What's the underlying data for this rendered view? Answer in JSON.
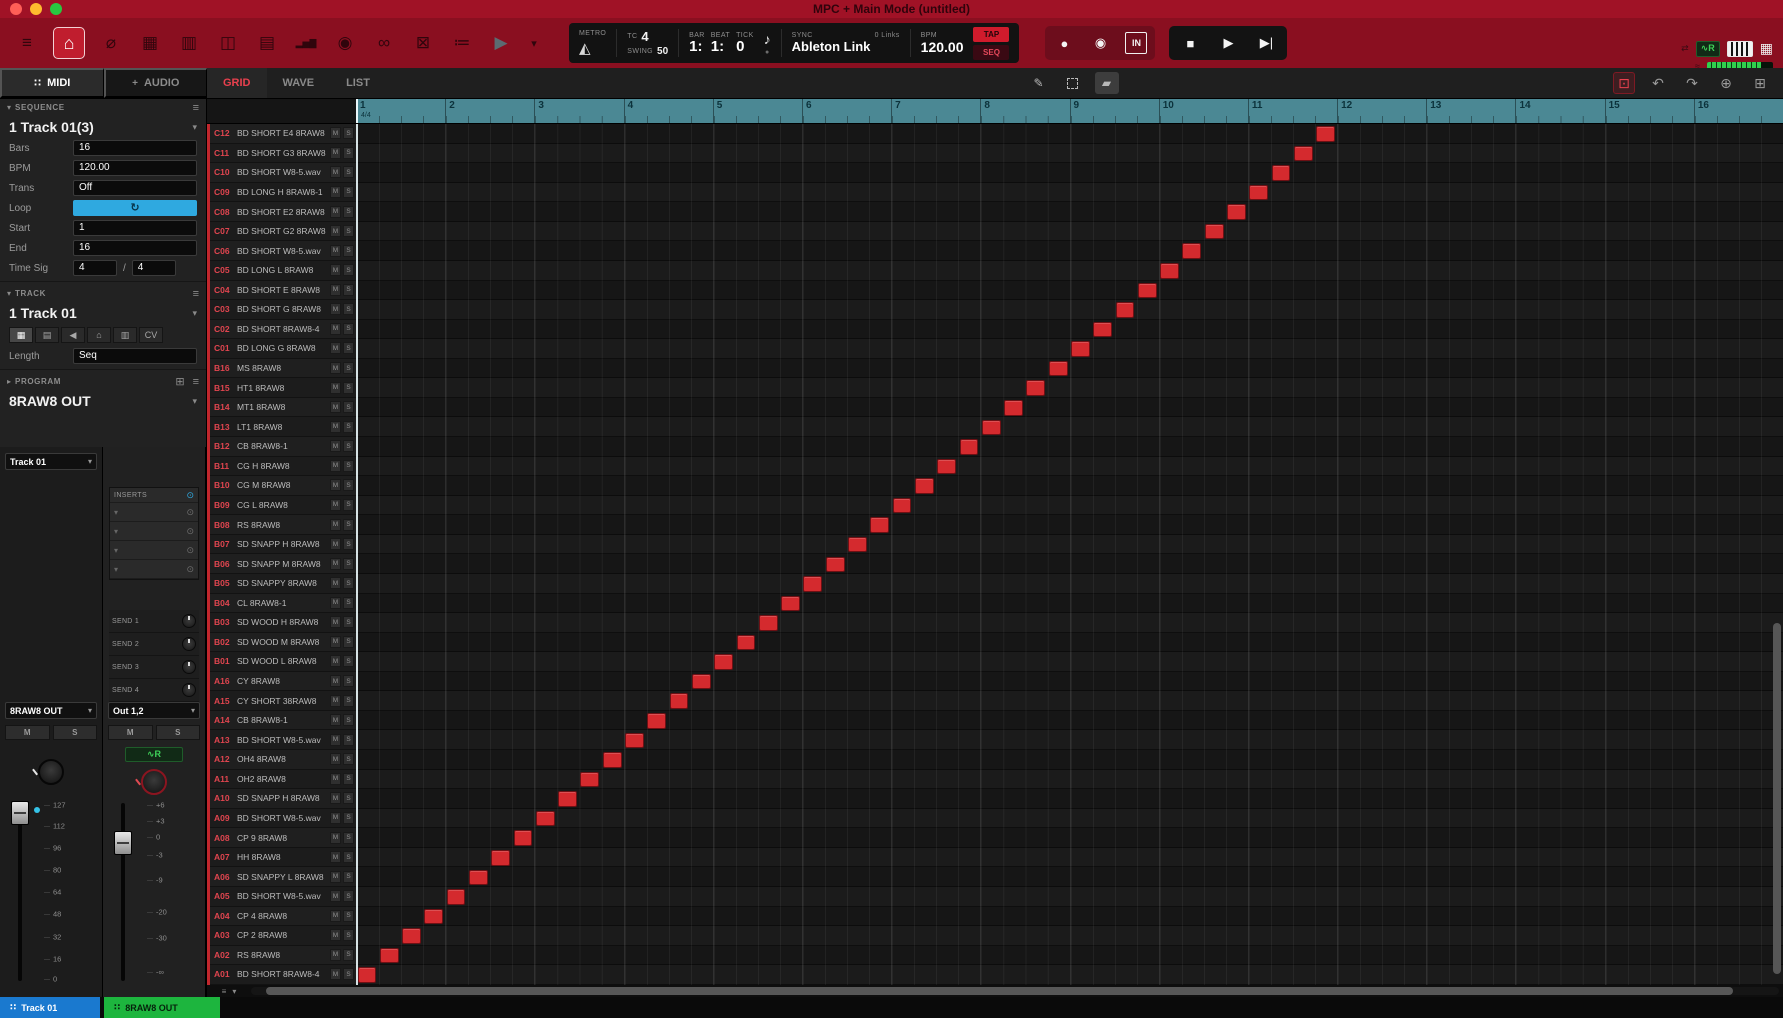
{
  "window": {
    "title": "MPC + Main Mode (untitled)"
  },
  "colors": {
    "accent_red": "#c1272d",
    "note": "#d42a2e",
    "ruler": "#4b8894",
    "loop_toggle": "#2fa9e0",
    "track_tab_blue": "#1a79cf",
    "program_tab_green": "#1db53e",
    "automation_green": "#3ed158"
  },
  "icons": {
    "menu": "≡",
    "main": "⌂",
    "zoom": "⌀",
    "track_view": "▦",
    "list_edit": "▥",
    "step_seq": "◫",
    "mixer": "▤",
    "sampler": "▂▅▇",
    "vinyl": "◉",
    "looper": "∞",
    "xyfx": "⊠",
    "next_seq": "≔",
    "arrow": "▶",
    "chevron_down": "▾",
    "chevron_right": "▸",
    "metronome": "◭",
    "note": "♪",
    "record": "●",
    "overdub": "◉",
    "punch_in": "IN",
    "stop": "■",
    "play": "▶",
    "play_start": "▶|",
    "pencil": "✎",
    "eraser": "▰",
    "undo": "↶",
    "redo": "↷",
    "step_record": "⊡",
    "move_tool": "⊕",
    "zoom_tool": "⊞",
    "automation": "∿R",
    "hamburger": "≡",
    "loop_toggle": "↻",
    "power": "⊙",
    "grid_dots": "∷",
    "program_add": "⊞",
    "speaker": "◀",
    "keys": "▤",
    "cv": "CV",
    "link": "⇄",
    "wave": "≈",
    "dot": "●"
  },
  "toolbar": {
    "transport": {
      "metro_label": "METRO",
      "tc_label": "TC",
      "tc_value": "4",
      "swing_label": "SWING",
      "swing_value": "50",
      "bar_label": "BAR",
      "beat_label": "BEAT",
      "tick_label": "TICK",
      "bar_value": "1:",
      "beat_value": "1:",
      "tick_value": "0",
      "sync_label": "SYNC",
      "links_value": "0 Links",
      "sync_value": "Ableton Link",
      "bpm_label": "BPM",
      "bpm_value": "120.00",
      "tap_label": "TAP",
      "seq_label": "SEQ"
    }
  },
  "panel_tabs": {
    "midi": "MIDI",
    "audio": "AUDIO",
    "audio_plus": "+"
  },
  "sequence": {
    "header": "SEQUENCE",
    "name": "1 Track 01(3)",
    "fields": {
      "bars": {
        "label": "Bars",
        "value": "16"
      },
      "bpm": {
        "label": "BPM",
        "value": "120.00"
      },
      "trans": {
        "label": "Trans",
        "value": "Off"
      },
      "loop": {
        "label": "Loop"
      },
      "start": {
        "label": "Start",
        "value": "1"
      },
      "end": {
        "label": "End",
        "value": "16"
      },
      "timesig": {
        "label": "Time Sig",
        "num": "4",
        "den": "4"
      }
    }
  },
  "track": {
    "header": "TRACK",
    "name": "1 Track 01",
    "length_label": "Length",
    "length_value": "Seq"
  },
  "program": {
    "header": "PROGRAM",
    "name": "8RAW8 OUT"
  },
  "mixer": {
    "track_select": "Track 01",
    "program_select": "8RAW8 OUT",
    "out_select": "Out 1,2",
    "inserts_label": "INSERTS",
    "sends": [
      "SEND 1",
      "SEND 2",
      "SEND 3",
      "SEND 4"
    ],
    "mute": "M",
    "solo": "S",
    "level_scale": [
      "127",
      "112",
      "96",
      "80",
      "64",
      "48",
      "32",
      "16",
      "0"
    ],
    "db_scale": [
      "+6",
      "+3",
      "0",
      "-3",
      "-9",
      "-20",
      "-30",
      "-∞"
    ]
  },
  "editor": {
    "tabs": {
      "grid": "GRID",
      "wave": "WAVE",
      "list": "LIST"
    },
    "time_sig": "4/4",
    "bar_numbers": [
      1,
      2,
      3,
      4,
      5,
      6,
      7,
      8,
      9,
      10,
      11,
      12,
      13,
      14,
      15,
      16
    ],
    "beats_per_bar": 4
  },
  "grid": {
    "mute": "M",
    "solo": "S",
    "rows": [
      {
        "id": "C12",
        "name": "BD SHORT E4 8RAW8"
      },
      {
        "id": "C11",
        "name": "BD SHORT G3 8RAW8"
      },
      {
        "id": "C10",
        "name": "BD SHORT W8-5.wav"
      },
      {
        "id": "C09",
        "name": "BD LONG H 8RAW8-1"
      },
      {
        "id": "C08",
        "name": "BD SHORT E2 8RAW8"
      },
      {
        "id": "C07",
        "name": "BD SHORT G2 8RAW8"
      },
      {
        "id": "C06",
        "name": "BD SHORT W8-5.wav"
      },
      {
        "id": "C05",
        "name": "BD LONG L 8RAW8"
      },
      {
        "id": "C04",
        "name": "BD SHORT E 8RAW8"
      },
      {
        "id": "C03",
        "name": "BD SHORT G 8RAW8"
      },
      {
        "id": "C02",
        "name": "BD SHORT 8RAW8-4"
      },
      {
        "id": "C01",
        "name": "BD LONG G 8RAW8"
      },
      {
        "id": "B16",
        "name": "MS 8RAW8"
      },
      {
        "id": "B15",
        "name": "HT1 8RAW8"
      },
      {
        "id": "B14",
        "name": "MT1 8RAW8"
      },
      {
        "id": "B13",
        "name": "LT1 8RAW8"
      },
      {
        "id": "B12",
        "name": "CB 8RAW8-1"
      },
      {
        "id": "B11",
        "name": "CG H 8RAW8"
      },
      {
        "id": "B10",
        "name": "CG M 8RAW8"
      },
      {
        "id": "B09",
        "name": "CG L 8RAW8"
      },
      {
        "id": "B08",
        "name": "RS 8RAW8"
      },
      {
        "id": "B07",
        "name": "SD SNAPP H 8RAW8"
      },
      {
        "id": "B06",
        "name": "SD SNAPP M 8RAW8"
      },
      {
        "id": "B05",
        "name": "SD SNAPPY 8RAW8"
      },
      {
        "id": "B04",
        "name": "CL 8RAW8-1"
      },
      {
        "id": "B03",
        "name": "SD WOOD H 8RAW8"
      },
      {
        "id": "B02",
        "name": "SD WOOD M 8RAW8"
      },
      {
        "id": "B01",
        "name": "SD WOOD L 8RAW8"
      },
      {
        "id": "A16",
        "name": "CY 8RAW8"
      },
      {
        "id": "A15",
        "name": "CY SHORT 38RAW8"
      },
      {
        "id": "A14",
        "name": "CB 8RAW8-1"
      },
      {
        "id": "A13",
        "name": "BD SHORT W8-5.wav"
      },
      {
        "id": "A12",
        "name": "OH4 8RAW8"
      },
      {
        "id": "A11",
        "name": "OH2 8RAW8"
      },
      {
        "id": "A10",
        "name": "SD SNAPP H 8RAW8"
      },
      {
        "id": "A09",
        "name": "BD SHORT W8-5.wav"
      },
      {
        "id": "A08",
        "name": "CP 9 8RAW8"
      },
      {
        "id": "A07",
        "name": "HH 8RAW8"
      },
      {
        "id": "A06",
        "name": "SD SNAPPY L 8RAW8"
      },
      {
        "id": "A05",
        "name": "BD SHORT W8-5.wav"
      },
      {
        "id": "A04",
        "name": "CP 4 8RAW8"
      },
      {
        "id": "A03",
        "name": "CP 2 8RAW8"
      },
      {
        "id": "A02",
        "name": "RS 8RAW8"
      },
      {
        "id": "A01",
        "name": "BD SHORT 8RAW8-4"
      }
    ],
    "notes": [
      {
        "row": "A01",
        "beat": 0
      },
      {
        "row": "A02",
        "beat": 1
      },
      {
        "row": "A03",
        "beat": 2
      },
      {
        "row": "A04",
        "beat": 3
      },
      {
        "row": "A05",
        "beat": 4
      },
      {
        "row": "A06",
        "beat": 5
      },
      {
        "row": "A07",
        "beat": 6
      },
      {
        "row": "A08",
        "beat": 7
      },
      {
        "row": "A09",
        "beat": 8
      },
      {
        "row": "A10",
        "beat": 9
      },
      {
        "row": "A11",
        "beat": 10
      },
      {
        "row": "A12",
        "beat": 11
      },
      {
        "row": "A13",
        "beat": 12
      },
      {
        "row": "A14",
        "beat": 13
      },
      {
        "row": "A15",
        "beat": 14
      },
      {
        "row": "A16",
        "beat": 15
      },
      {
        "row": "B01",
        "beat": 16
      },
      {
        "row": "B02",
        "beat": 17
      },
      {
        "row": "B03",
        "beat": 18
      },
      {
        "row": "B04",
        "beat": 19
      },
      {
        "row": "B05",
        "beat": 20
      },
      {
        "row": "B06",
        "beat": 21
      },
      {
        "row": "B07",
        "beat": 22
      },
      {
        "row": "B08",
        "beat": 23
      },
      {
        "row": "B09",
        "beat": 24
      },
      {
        "row": "B10",
        "beat": 25
      },
      {
        "row": "B11",
        "beat": 26
      },
      {
        "row": "B12",
        "beat": 27
      },
      {
        "row": "B13",
        "beat": 28
      },
      {
        "row": "B14",
        "beat": 29
      },
      {
        "row": "B15",
        "beat": 30
      },
      {
        "row": "B16",
        "beat": 31
      },
      {
        "row": "C01",
        "beat": 32
      },
      {
        "row": "C02",
        "beat": 33
      },
      {
        "row": "C03",
        "beat": 34
      },
      {
        "row": "C04",
        "beat": 35
      },
      {
        "row": "C05",
        "beat": 36
      },
      {
        "row": "C06",
        "beat": 37
      },
      {
        "row": "C07",
        "beat": 38
      },
      {
        "row": "C08",
        "beat": 39
      },
      {
        "row": "C09",
        "beat": 40
      },
      {
        "row": "C10",
        "beat": 41
      },
      {
        "row": "C11",
        "beat": 42
      },
      {
        "row": "C12",
        "beat": 43
      }
    ]
  },
  "bottom_bar": {
    "track_tab": "Track 01",
    "program_tab": "8RAW8 OUT"
  }
}
